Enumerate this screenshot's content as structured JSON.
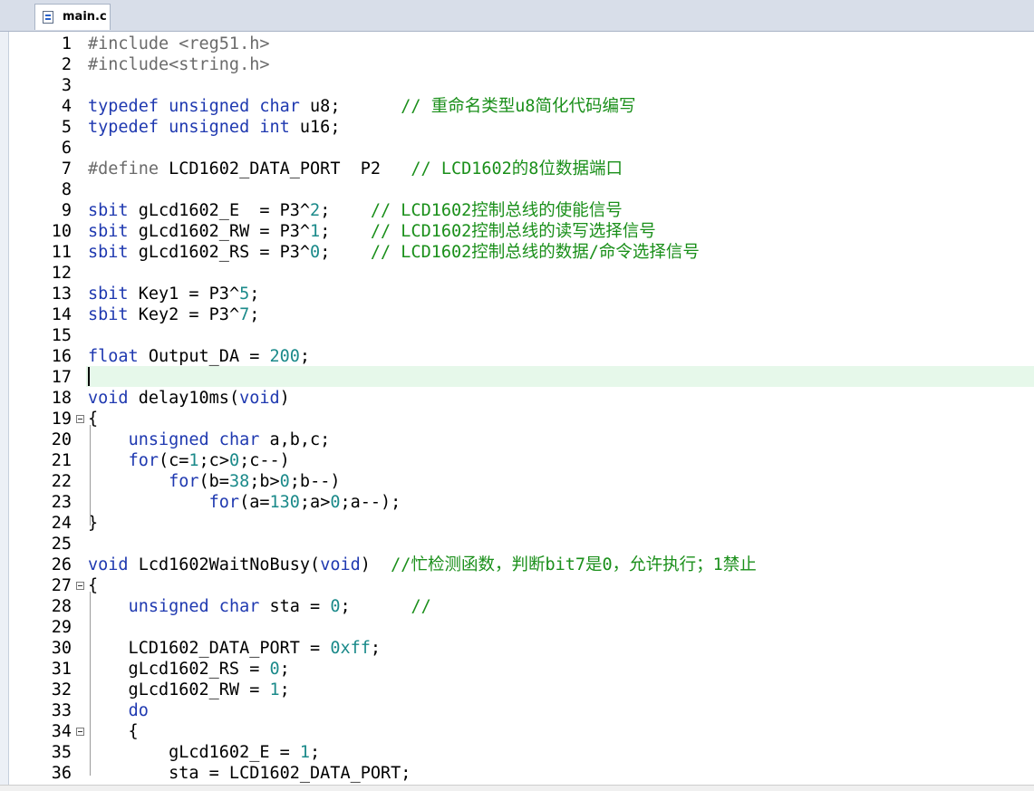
{
  "tab": {
    "label": "main.c"
  },
  "editor": {
    "current_line": 17,
    "lines": [
      {
        "n": "1",
        "code": [
          {
            "t": "#include <reg51.h>",
            "c": "pp"
          }
        ]
      },
      {
        "n": "2",
        "code": [
          {
            "t": "#include<string.h>",
            "c": "pp"
          }
        ]
      },
      {
        "n": "3",
        "code": []
      },
      {
        "n": "4",
        "code": [
          {
            "t": "typedef unsigned char",
            "c": "kw"
          },
          {
            "t": " u8;      "
          },
          {
            "t": "// 重命名类型u8简化代码编写",
            "c": "cm"
          }
        ]
      },
      {
        "n": "5",
        "code": [
          {
            "t": "typedef unsigned int",
            "c": "kw"
          },
          {
            "t": " u16;"
          }
        ]
      },
      {
        "n": "6",
        "code": []
      },
      {
        "n": "7",
        "code": [
          {
            "t": "#define",
            "c": "pp"
          },
          {
            "t": " LCD1602_DATA_PORT  P2   "
          },
          {
            "t": "// LCD1602的8位数据端口",
            "c": "cm"
          }
        ]
      },
      {
        "n": "8",
        "code": []
      },
      {
        "n": "9",
        "code": [
          {
            "t": "sbit",
            "c": "kw"
          },
          {
            "t": " gLcd1602_E  = P3^"
          },
          {
            "t": "2",
            "c": "nm"
          },
          {
            "t": ";    "
          },
          {
            "t": "// LCD1602控制总线的使能信号",
            "c": "cm"
          }
        ]
      },
      {
        "n": "10",
        "code": [
          {
            "t": "sbit",
            "c": "kw"
          },
          {
            "t": " gLcd1602_RW = P3^"
          },
          {
            "t": "1",
            "c": "nm"
          },
          {
            "t": ";    "
          },
          {
            "t": "// LCD1602控制总线的读写选择信号",
            "c": "cm"
          }
        ]
      },
      {
        "n": "11",
        "code": [
          {
            "t": "sbit",
            "c": "kw"
          },
          {
            "t": " gLcd1602_RS = P3^"
          },
          {
            "t": "0",
            "c": "nm"
          },
          {
            "t": ";    "
          },
          {
            "t": "// LCD1602控制总线的数据/命令选择信号",
            "c": "cm"
          }
        ]
      },
      {
        "n": "12",
        "code": []
      },
      {
        "n": "13",
        "code": [
          {
            "t": "sbit",
            "c": "kw"
          },
          {
            "t": " Key1 = P3^"
          },
          {
            "t": "5",
            "c": "nm"
          },
          {
            "t": ";"
          }
        ]
      },
      {
        "n": "14",
        "code": [
          {
            "t": "sbit",
            "c": "kw"
          },
          {
            "t": " Key2 = P3^"
          },
          {
            "t": "7",
            "c": "nm"
          },
          {
            "t": ";"
          }
        ]
      },
      {
        "n": "15",
        "code": []
      },
      {
        "n": "16",
        "code": [
          {
            "t": "float",
            "c": "kw"
          },
          {
            "t": " Output_DA = "
          },
          {
            "t": "200",
            "c": "nm"
          },
          {
            "t": ";"
          }
        ]
      },
      {
        "n": "17",
        "code": []
      },
      {
        "n": "18",
        "code": [
          {
            "t": "void",
            "c": "kw"
          },
          {
            "t": " delay10ms("
          },
          {
            "t": "void",
            "c": "kw"
          },
          {
            "t": ")"
          }
        ]
      },
      {
        "n": "19",
        "fold": true,
        "code": [
          {
            "t": "{"
          }
        ]
      },
      {
        "n": "20",
        "code": [
          {
            "t": "    "
          },
          {
            "t": "unsigned char",
            "c": "kw"
          },
          {
            "t": " a,b,c;"
          }
        ]
      },
      {
        "n": "21",
        "code": [
          {
            "t": "    "
          },
          {
            "t": "for",
            "c": "kw"
          },
          {
            "t": "(c="
          },
          {
            "t": "1",
            "c": "nm"
          },
          {
            "t": ";c>"
          },
          {
            "t": "0",
            "c": "nm"
          },
          {
            "t": ";c--)"
          }
        ]
      },
      {
        "n": "22",
        "code": [
          {
            "t": "        "
          },
          {
            "t": "for",
            "c": "kw"
          },
          {
            "t": "(b="
          },
          {
            "t": "38",
            "c": "nm"
          },
          {
            "t": ";b>"
          },
          {
            "t": "0",
            "c": "nm"
          },
          {
            "t": ";b--)"
          }
        ]
      },
      {
        "n": "23",
        "code": [
          {
            "t": "            "
          },
          {
            "t": "for",
            "c": "kw"
          },
          {
            "t": "(a="
          },
          {
            "t": "130",
            "c": "nm"
          },
          {
            "t": ";a>"
          },
          {
            "t": "0",
            "c": "nm"
          },
          {
            "t": ";a--);"
          }
        ]
      },
      {
        "n": "24",
        "code": [
          {
            "t": "}"
          }
        ]
      },
      {
        "n": "25",
        "code": []
      },
      {
        "n": "26",
        "code": [
          {
            "t": "void",
            "c": "kw"
          },
          {
            "t": " Lcd1602WaitNoBusy("
          },
          {
            "t": "void",
            "c": "kw"
          },
          {
            "t": ")  "
          },
          {
            "t": "//忙检测函数，判断bit7是0，允许执行；1禁止",
            "c": "cm"
          }
        ]
      },
      {
        "n": "27",
        "fold": true,
        "code": [
          {
            "t": "{"
          }
        ]
      },
      {
        "n": "28",
        "code": [
          {
            "t": "    "
          },
          {
            "t": "unsigned char",
            "c": "kw"
          },
          {
            "t": " sta = "
          },
          {
            "t": "0",
            "c": "nm"
          },
          {
            "t": ";      "
          },
          {
            "t": "//",
            "c": "cm"
          }
        ]
      },
      {
        "n": "29",
        "code": []
      },
      {
        "n": "30",
        "code": [
          {
            "t": "    LCD1602_DATA_PORT = "
          },
          {
            "t": "0xff",
            "c": "nm"
          },
          {
            "t": ";"
          }
        ]
      },
      {
        "n": "31",
        "code": [
          {
            "t": "    gLcd1602_RS = "
          },
          {
            "t": "0",
            "c": "nm"
          },
          {
            "t": ";"
          }
        ]
      },
      {
        "n": "32",
        "code": [
          {
            "t": "    gLcd1602_RW = "
          },
          {
            "t": "1",
            "c": "nm"
          },
          {
            "t": ";"
          }
        ]
      },
      {
        "n": "33",
        "code": [
          {
            "t": "    "
          },
          {
            "t": "do",
            "c": "kw"
          }
        ]
      },
      {
        "n": "34",
        "fold": true,
        "code": [
          {
            "t": "    {"
          }
        ]
      },
      {
        "n": "35",
        "code": [
          {
            "t": "        gLcd1602_E = "
          },
          {
            "t": "1",
            "c": "nm"
          },
          {
            "t": ";"
          }
        ]
      },
      {
        "n": "36",
        "code": [
          {
            "t": "        sta = LCD1602_DATA_PORT;"
          }
        ]
      }
    ]
  }
}
